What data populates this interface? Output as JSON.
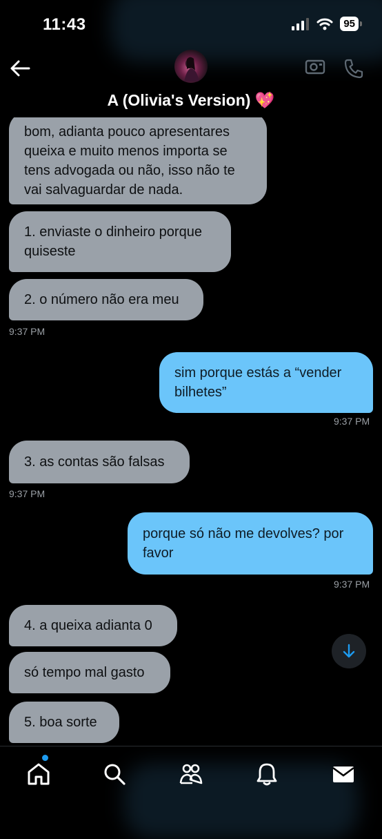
{
  "status_bar": {
    "time": "11:43",
    "battery": "95",
    "icons": [
      "signal-icon",
      "wifi-icon",
      "battery-icon"
    ]
  },
  "header": {
    "title": "A (Olivia's Version) 💖",
    "icons": [
      "back-arrow-icon",
      "video-call-icon",
      "phone-icon"
    ]
  },
  "messages": [
    {
      "side": "received",
      "text": "bom, adianta pouco apresentares queixa e muito menos importa se tens advogada ou não, isso não te vai salvaguardar de nada."
    },
    {
      "side": "received",
      "text": "1. enviaste o dinheiro porque quiseste"
    },
    {
      "side": "received",
      "text": "2. o número não era meu",
      "time": "9:37 PM"
    },
    {
      "side": "sent",
      "text": "sim porque estás a “vender bilhetes”",
      "time": "9:37 PM"
    },
    {
      "side": "received",
      "text": "3. as contas são falsas",
      "time": "9:37 PM"
    },
    {
      "side": "sent",
      "text": "porque só não me devolves? por favor",
      "time": "9:37 PM"
    },
    {
      "side": "received",
      "text": "4. a queixa adianta 0"
    },
    {
      "side": "received",
      "text": "só tempo mal gasto"
    },
    {
      "side": "received",
      "text": "5. boa sorte"
    }
  ],
  "bottom_nav": {
    "items": [
      "home-icon",
      "search-icon",
      "communities-icon",
      "notifications-icon",
      "messages-icon"
    ],
    "active": "home-icon",
    "accent": "#1d9bf0"
  },
  "colors": {
    "received_bubble": "#9aa1a9",
    "sent_bubble": "#6bc5fa",
    "background": "#000000"
  }
}
